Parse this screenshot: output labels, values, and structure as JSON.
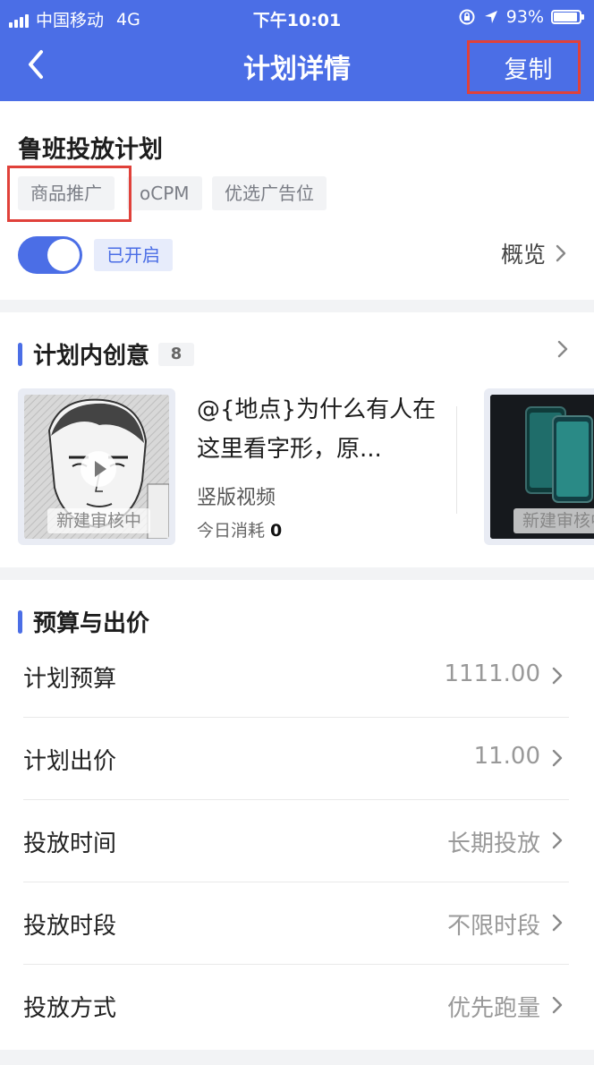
{
  "status_bar": {
    "carrier": "中国移动",
    "network": "4G",
    "time": "下午10:01",
    "battery": "93%"
  },
  "nav": {
    "title": "计划详情",
    "copy_label": "复制"
  },
  "plan": {
    "name": "鲁班投放计划",
    "tags": [
      "商品推广",
      "oCPM",
      "优选广告位"
    ],
    "toggle_on": true,
    "status_label": "已开启",
    "overview_label": "概览"
  },
  "creatives": {
    "title": "计划内创意",
    "count": "8",
    "items": [
      {
        "title": "@{地点}为什么有人在这里看字形，原...",
        "type": "竖版视频",
        "spend_label": "今日消耗",
        "spend_value": "0",
        "review_status": "新建审核中"
      },
      {
        "review_status": "新建审核中"
      }
    ]
  },
  "budget": {
    "title": "预算与出价",
    "rows": [
      {
        "label": "计划预算",
        "value": "1111.00"
      },
      {
        "label": "计划出价",
        "value": "11.00"
      },
      {
        "label": "投放时间",
        "value": "长期投放"
      },
      {
        "label": "投放时段",
        "value": "不限时段"
      },
      {
        "label": "投放方式",
        "value": "优先跑量"
      }
    ]
  },
  "colors": {
    "primary": "#4b6ee6",
    "highlight_border": "#e0413a"
  }
}
